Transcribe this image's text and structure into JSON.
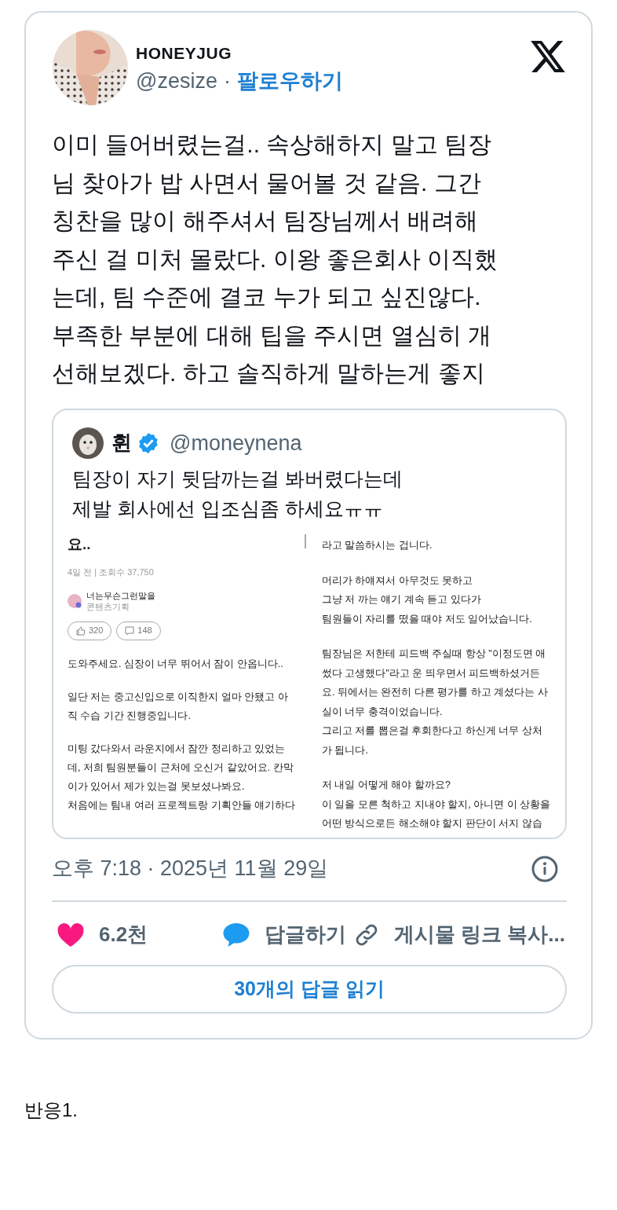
{
  "tweet": {
    "author": {
      "name": "HONEYJUG",
      "handle": "@zesize",
      "separator": "·",
      "follow": "팔로우하기"
    },
    "text_lines": [
      "이미 들어버렸는걸.. 속상해하지 말고 팀장",
      "님 찾아가 밥 사면서 물어볼 것 같음. 그간",
      "칭찬을 많이 해주셔서 팀장님께서 배려해",
      "주신 걸 미처 몰랐다. 이왕 좋은회사 이직했",
      "는데, 팀 수준에 결코 누가 되고 싶진않다.",
      "부족한 부분에 대해 팁을 주시면 열심히 개",
      "선해보겠다. 하고 솔직하게 말하는게 좋지"
    ],
    "quote": {
      "name": "휜",
      "verified": true,
      "handle": "@moneynena",
      "text_lines": [
        "팀장이 자기 뒷담까는걸 봐버렸다는데",
        "제발 회사에선 입조심좀 하세요ㅠㅠ"
      ],
      "screenshot": {
        "left": {
          "title": "요..",
          "meta": "4일 전 | 조회수 37,750",
          "author": "너는무슨그런말을",
          "author_role": "콘텐츠기획",
          "likes": "320",
          "comments": "148",
          "paragraphs": [
            [
              "도와주세요. 심장이 너무 뛰어서 잠이 안옵니다.."
            ],
            [
              "일단 저는 중고신입으로 이직한지 얼마 안됐고 아",
              "직 수습 기간 진행중입니다."
            ],
            [
              "미팅 갔다와서 라운지에서 잠깐 정리하고 있었는",
              "데, 저희 팀원분들이 근처에 오신거 같았어요. 칸막",
              "이가 있어서 제가 있는걸 못보셨나봐요.",
              "처음에는 팀내 여러 프로젝트랑 기획안들 얘기하다"
            ]
          ]
        },
        "right": {
          "paragraphs": [
            [
              "라고 말씀하시는 겁니다."
            ],
            [
              "머리가 하얘져서 아무것도 못하고",
              "그냥 저 까는 얘기 계속 듣고 있다가",
              "팀원들이 자리를 떴을 때야 저도 일어났습니다."
            ],
            [
              "팀장님은 저한테 피드백 주실때 항상 \"이정도면 애",
              "썼다 고생했다\"라고 운 띄우면서 피드백하셨거든",
              "요. 뒤에서는 완전히 다른 평가를 하고 계셨다는 사",
              "실이 너무 충격이었습니다.",
              "그리고 저를 뽑은걸 후회한다고 하신게 너무 상처",
              "가 됩니다."
            ],
            [
              "저 내일 어떻게 해야 할까요?",
              "이 일을 모른 척하고 지내야 할지, 아니면 이 상황을",
              "어떤 방식으로든 해소해야 할지 판단이 서지 않습"
            ]
          ]
        }
      }
    },
    "timestamp": "오후 7:18 · 2025년 11월 29일",
    "actions": [
      {
        "kind": "like",
        "label": "6.2천"
      },
      {
        "kind": "reply",
        "label": "답글하기"
      },
      {
        "kind": "link",
        "label": "게시물 링크 복사..."
      }
    ],
    "read_replies": "30개의 답글 읽기"
  },
  "caption": "반응1."
}
